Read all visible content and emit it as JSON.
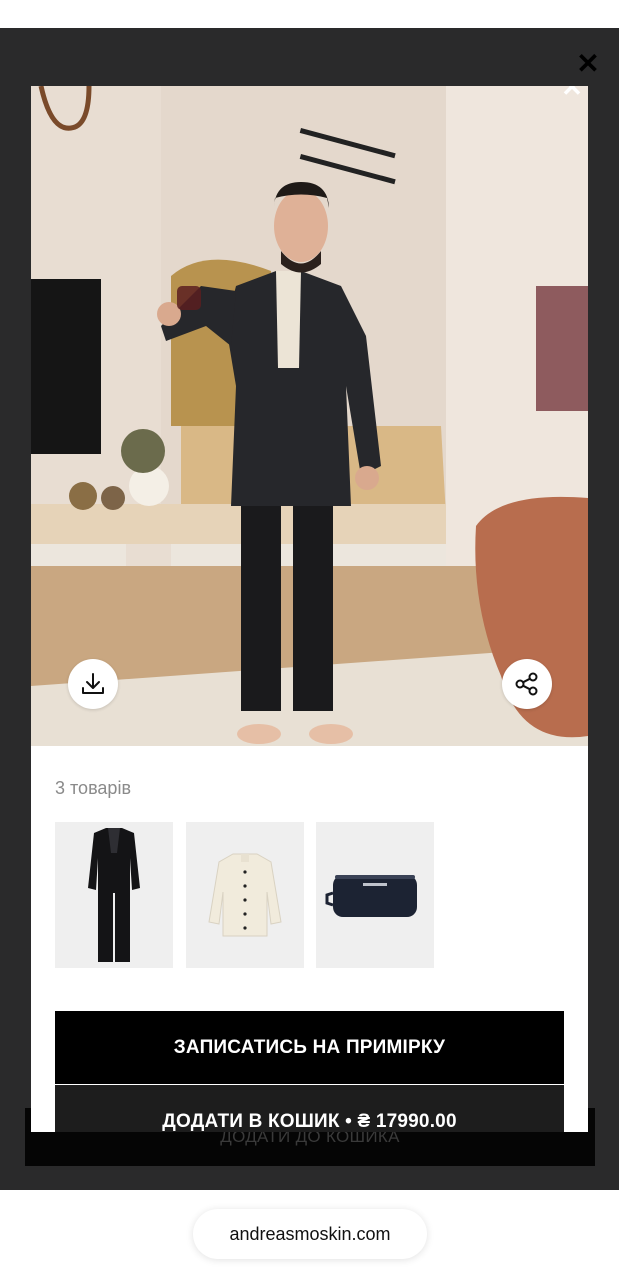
{
  "modal": {
    "close_glyph": "✕",
    "items_count_label": "3 товарів",
    "products": [
      {
        "name": "suit",
        "icon": "suit-icon"
      },
      {
        "name": "shirt",
        "icon": "shirt-icon"
      },
      {
        "name": "bag",
        "icon": "toiletry-bag-icon"
      }
    ],
    "book_fitting_label": "ЗАПИСАТИСЬ НА ПРИМІРКУ",
    "add_to_cart_label": "ДОДАТИ В КОШИК • ₴ 17990.00"
  },
  "background_page": {
    "add_to_cart_label": "ДОДАТИ ДО КОШИКА"
  },
  "browser": {
    "url": "andreasmoskin.com"
  },
  "colors": {
    "overlay": "#2a2a2b",
    "button_primary": "#000000",
    "button_secondary": "#1d1d1d",
    "muted_text": "#8a8a8a"
  }
}
